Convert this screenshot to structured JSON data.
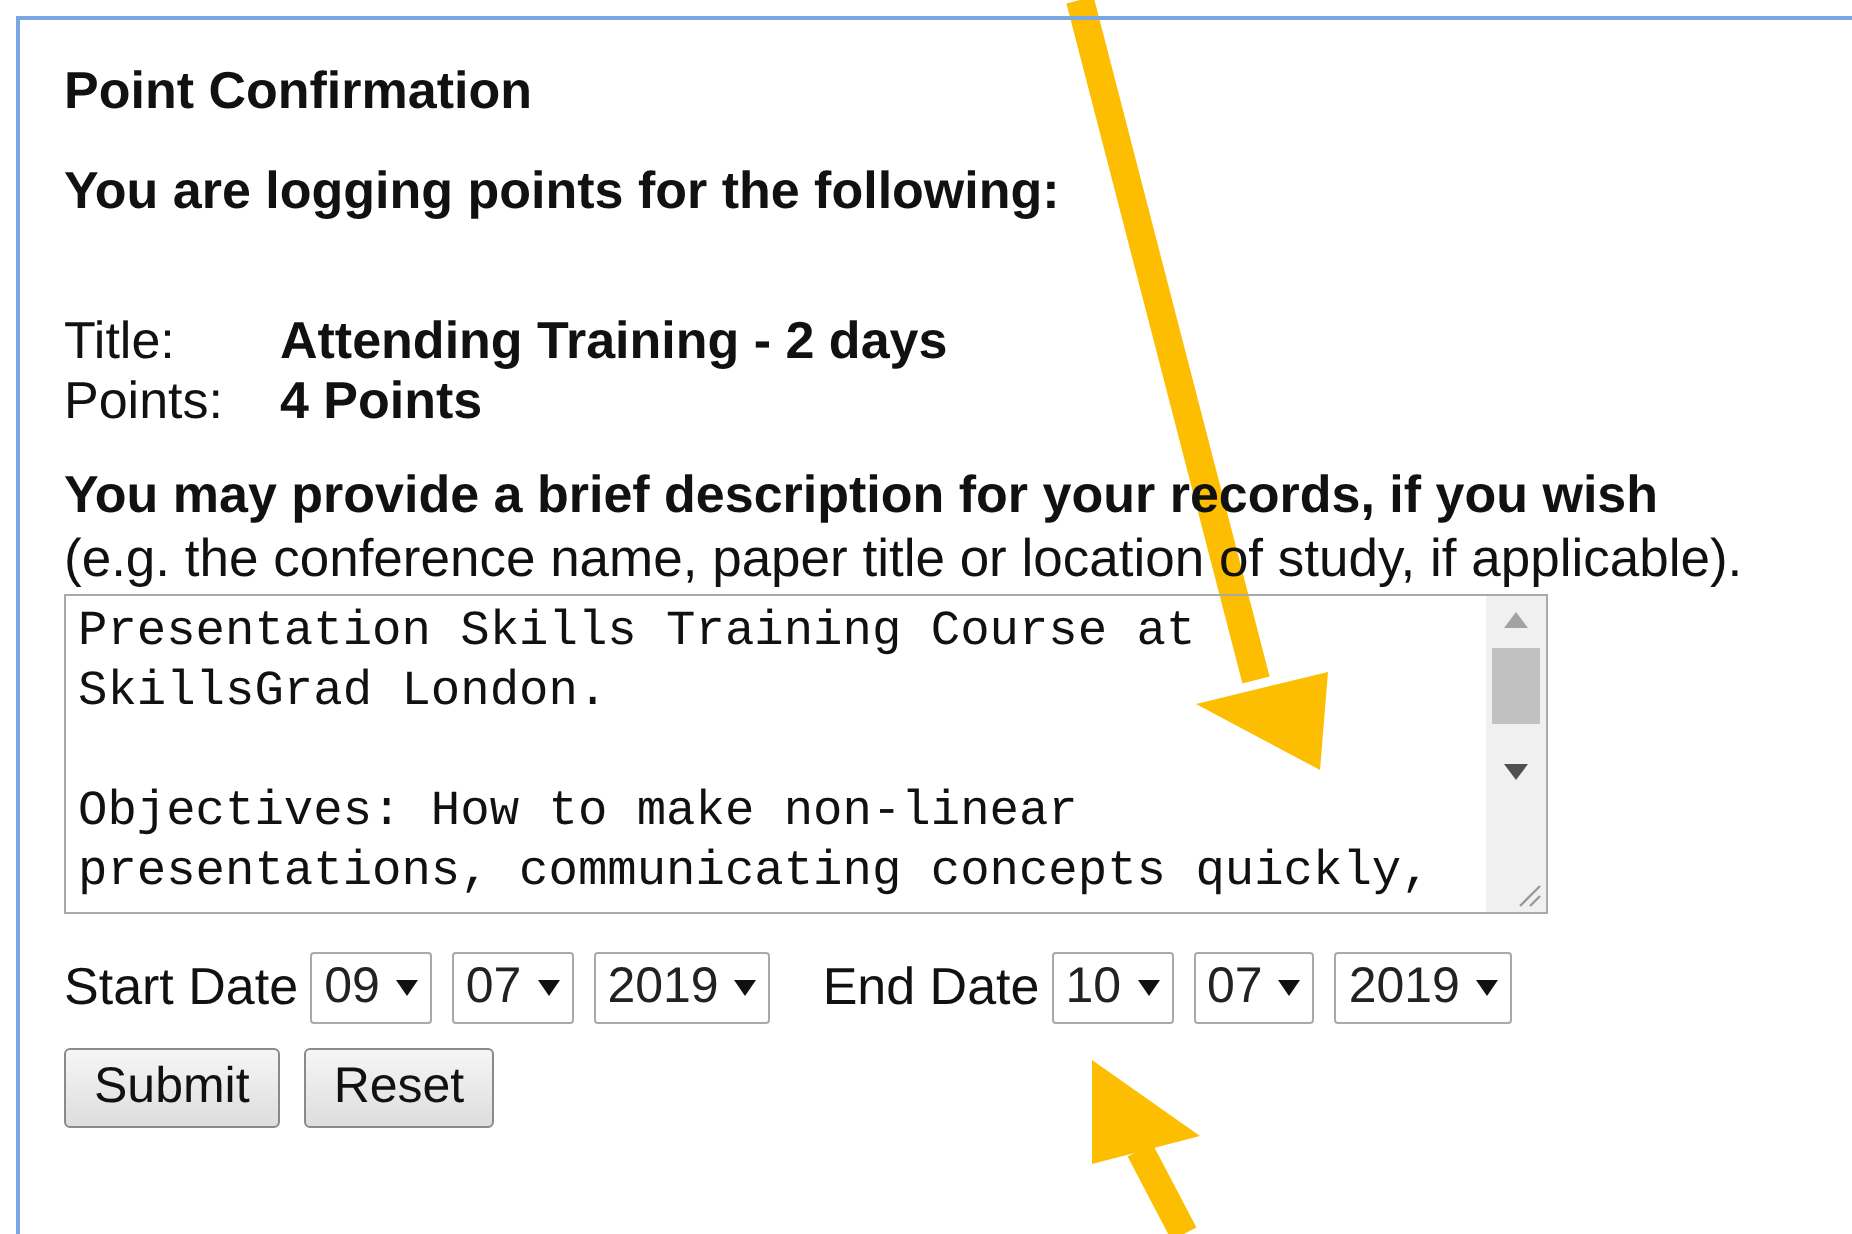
{
  "heading": "Point Confirmation",
  "intro": "You are logging points for the following:",
  "details": [
    {
      "label": "Title:",
      "value": "Attending Training - 2 days"
    },
    {
      "label": "Points:",
      "value": "4 Points"
    }
  ],
  "description_prompt": "You may provide a brief description for your records, if you wish",
  "description_hint": "(e.g. the conference name, paper title or location of study, if applicable).",
  "description": {
    "paragraphs": [
      "Presentation Skills Training Course at SkillsGrad London.",
      "Objectives: How to make non-linear presentations, communicating concepts quickly,"
    ]
  },
  "dates": [
    {
      "label": "Start Date",
      "day": "09",
      "month": "07",
      "year": "2019"
    },
    {
      "label": "End Date",
      "day": "10",
      "month": "07",
      "year": "2019"
    }
  ],
  "buttons": [
    "Submit",
    "Reset"
  ]
}
